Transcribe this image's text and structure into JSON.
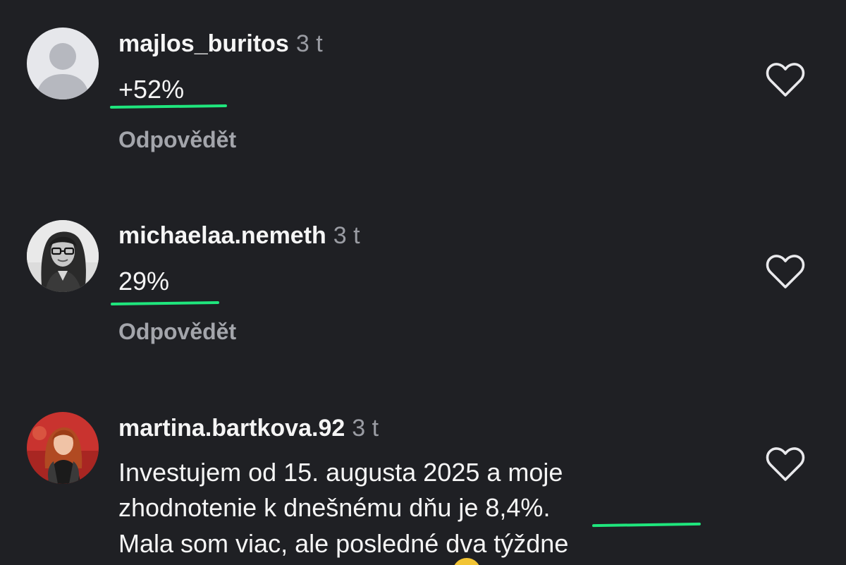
{
  "comments": [
    {
      "username": "majlos_buritos",
      "time": "3 t",
      "text": "+52%",
      "reply_label": "Odpovědět",
      "avatar": "default-avatar"
    },
    {
      "username": "michaelaa.nemeth",
      "time": "3 t",
      "text": "29%",
      "reply_label": "Odpovědět",
      "avatar": "user-photo"
    },
    {
      "username": "martina.bartkova.92",
      "time": "3 t",
      "lines": [
        "Investujem od 15. augusta 2025 a moje",
        "zhodnotenie k dnešnému dňu je 8,4%.",
        "Mala som viac, ale posledné dva týždne"
      ],
      "avatar": "user-photo"
    }
  ],
  "icons": {
    "like": "heart-outline-icon",
    "default_avatar": "person-silhouette-icon"
  },
  "colors": {
    "background": "#1f2024",
    "highlight_underline": "#1fe67d",
    "secondary_text": "#9a9ca3"
  }
}
